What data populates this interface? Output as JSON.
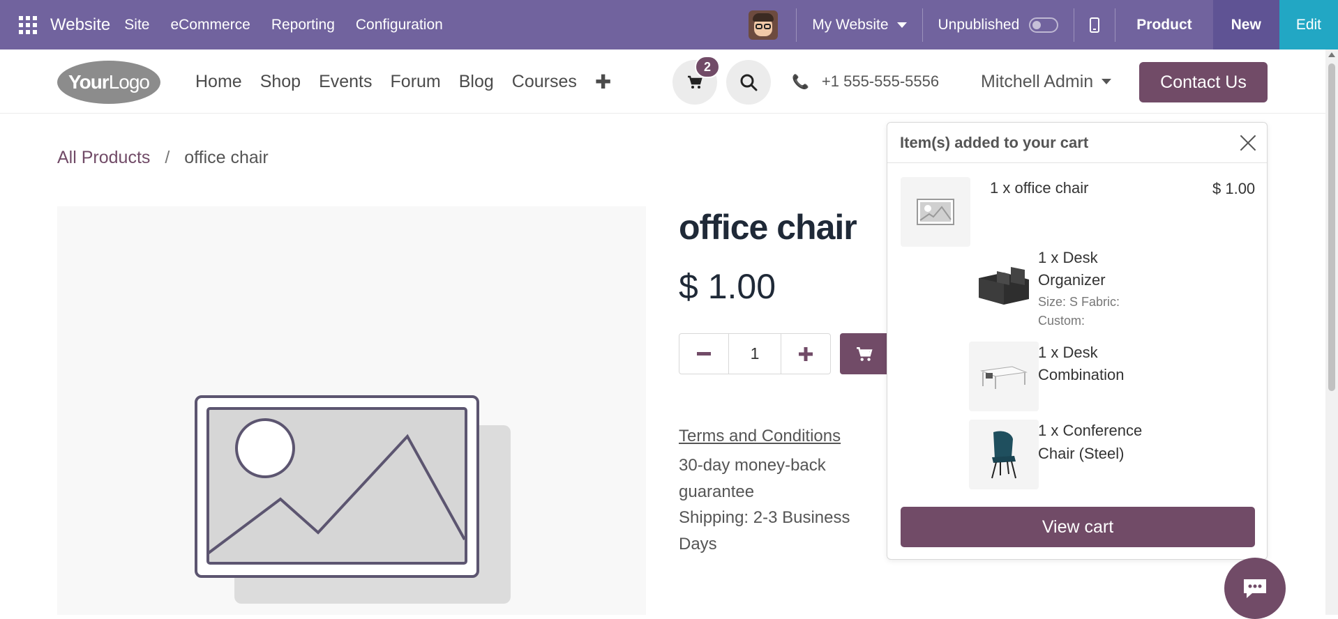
{
  "topbar": {
    "app_name": "Website",
    "menus": [
      "Site",
      "eCommerce",
      "Reporting",
      "Configuration"
    ],
    "website_selector": "My Website",
    "publish_status": "Unpublished",
    "product_label": "Product",
    "new_label": "New",
    "edit_label": "Edit"
  },
  "header": {
    "logo_bold": "Your",
    "logo_light": "Logo",
    "nav": [
      "Home",
      "Shop",
      "Events",
      "Forum",
      "Blog",
      "Courses"
    ],
    "cart_count": "2",
    "phone": "+1 555-555-5556",
    "user": "Mitchell Admin",
    "contact_button": "Contact Us"
  },
  "breadcrumb": {
    "parent": "All Products",
    "separator": "/",
    "current": "office chair"
  },
  "product": {
    "name": "office chair",
    "price": "$ 1.00",
    "quantity": "1",
    "terms": "Terms and Conditions",
    "guarantee_line1": "30-day money-back",
    "guarantee_line2": "guarantee",
    "shipping_line1": "Shipping: 2-3 Business",
    "shipping_line2": "Days"
  },
  "cart_popover": {
    "title": "Item(s) added to your cart",
    "items": [
      {
        "name": "1 x office chair",
        "price": "$ 1.00"
      },
      {
        "name_line1": "1 x Desk",
        "name_line2": "Organizer",
        "attr_line1": "Size: S Fabric:",
        "attr_line2": "Custom:"
      },
      {
        "name_line1": "1 x Desk",
        "name_line2": "Combination"
      },
      {
        "name_line1": "1 x Conference",
        "name_line2": "Chair (Steel)"
      }
    ],
    "view_cart": "View cart"
  },
  "colors": {
    "odoo_bar": "#71639e",
    "brand": "#714b67",
    "edit": "#22a7c4"
  }
}
